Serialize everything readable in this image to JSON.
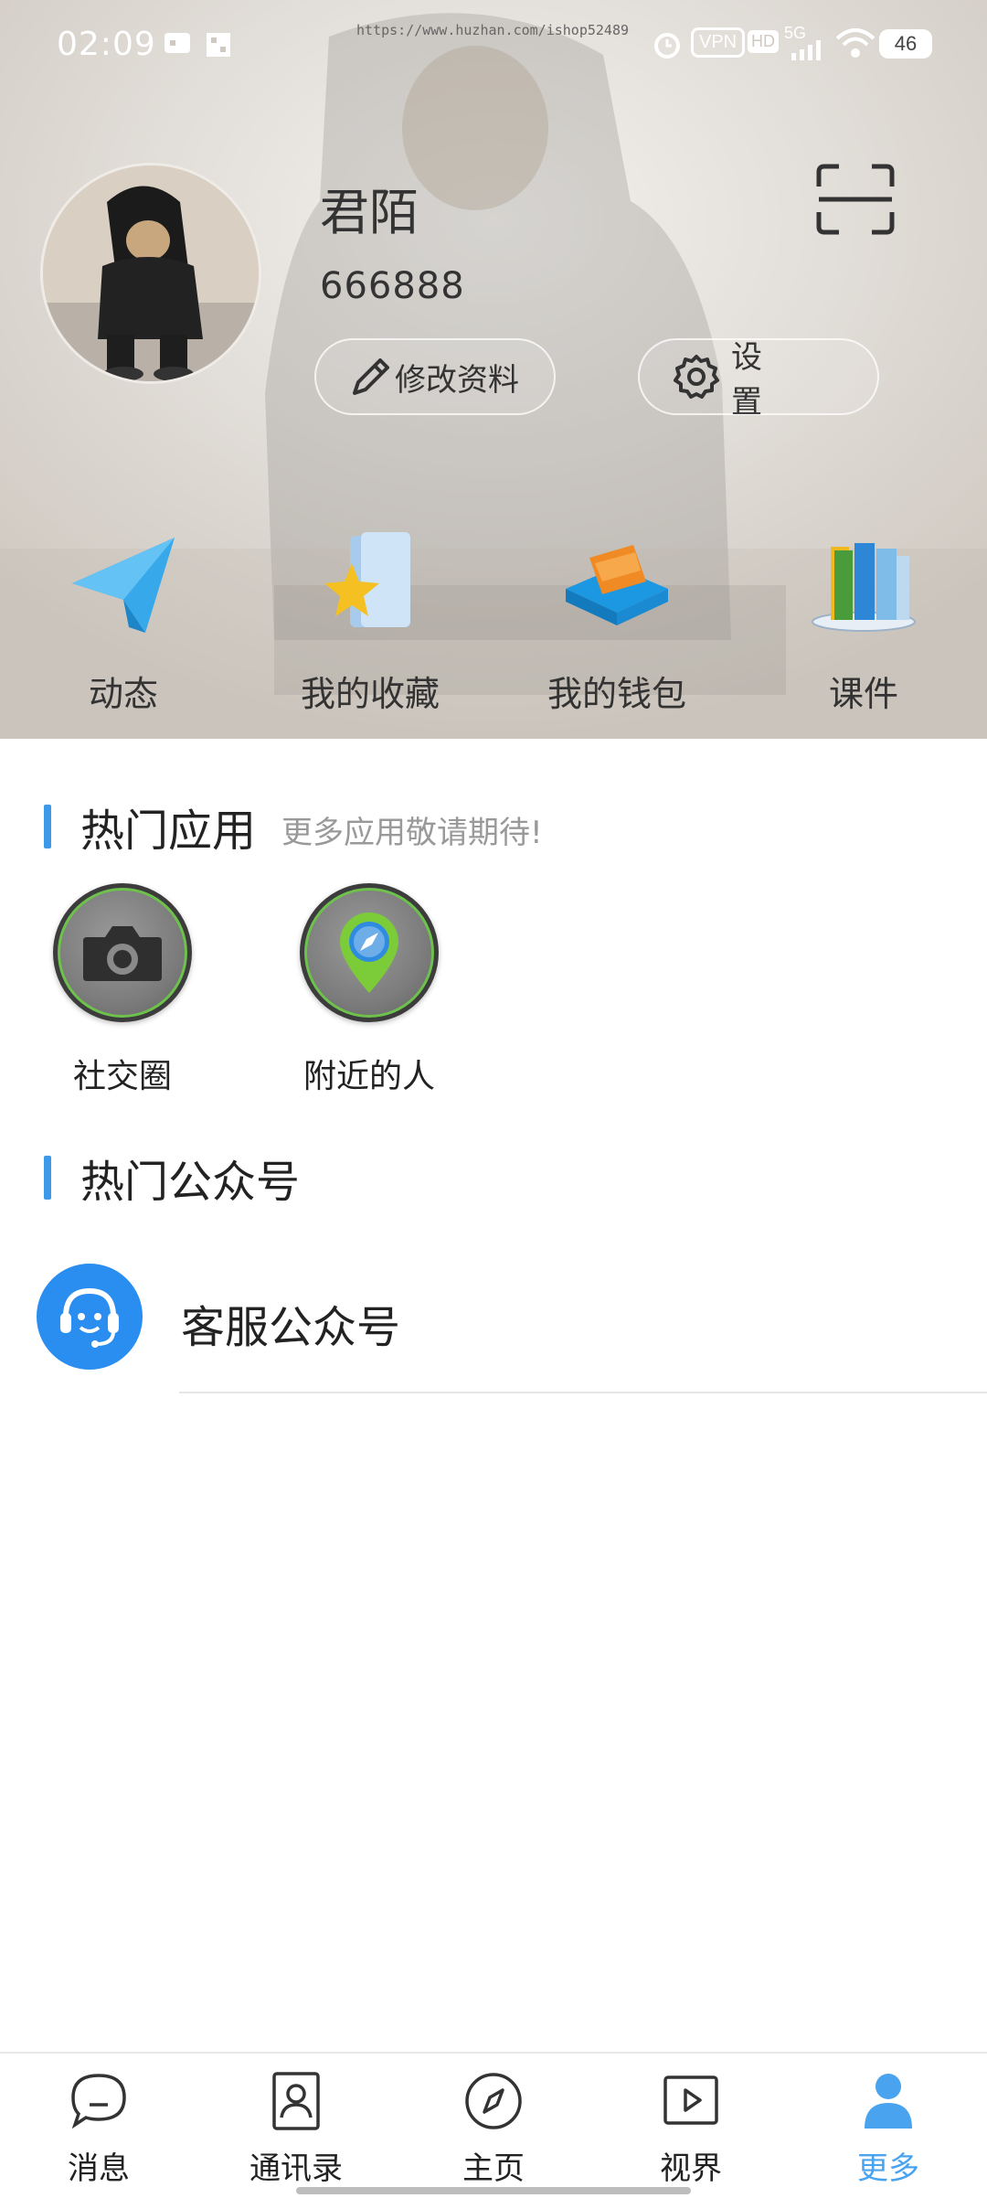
{
  "status_bar": {
    "time": "02:09",
    "url": "https://www.huzhan.com/ishop52489",
    "vpn": "VPN",
    "hd": "HD",
    "network": "5G",
    "battery": "46"
  },
  "profile": {
    "name": "君陌",
    "id": "666888",
    "edit_label": "修改资料",
    "settings_label": "设置",
    "scan_icon": "scan-icon"
  },
  "quick_actions": [
    {
      "label": "动态",
      "icon": "paper-plane-icon"
    },
    {
      "label": "我的收藏",
      "icon": "star-folder-icon"
    },
    {
      "label": "我的钱包",
      "icon": "wallet-icon"
    },
    {
      "label": "课件",
      "icon": "books-icon"
    }
  ],
  "hot_apps": {
    "title": "热门应用",
    "subtitle": "更多应用敬请期待!",
    "items": [
      {
        "label": "社交圈",
        "icon": "camera-icon"
      },
      {
        "label": "附近的人",
        "icon": "location-pin-icon"
      }
    ]
  },
  "hot_accounts": {
    "title": "热门公众号",
    "items": [
      {
        "label": "客服公众号",
        "icon": "customer-service-icon"
      }
    ]
  },
  "bottom_nav": {
    "items": [
      {
        "label": "消息",
        "icon": "chat-bubble-icon"
      },
      {
        "label": "通讯录",
        "icon": "contacts-icon"
      },
      {
        "label": "主页",
        "icon": "compass-icon"
      },
      {
        "label": "视界",
        "icon": "video-play-icon"
      },
      {
        "label": "更多",
        "icon": "person-icon"
      }
    ],
    "active": "更多"
  },
  "colors": {
    "accent": "#3d9ae8",
    "nav_active": "#4aa3ee",
    "service_icon_bg": "#2a8ef0"
  }
}
